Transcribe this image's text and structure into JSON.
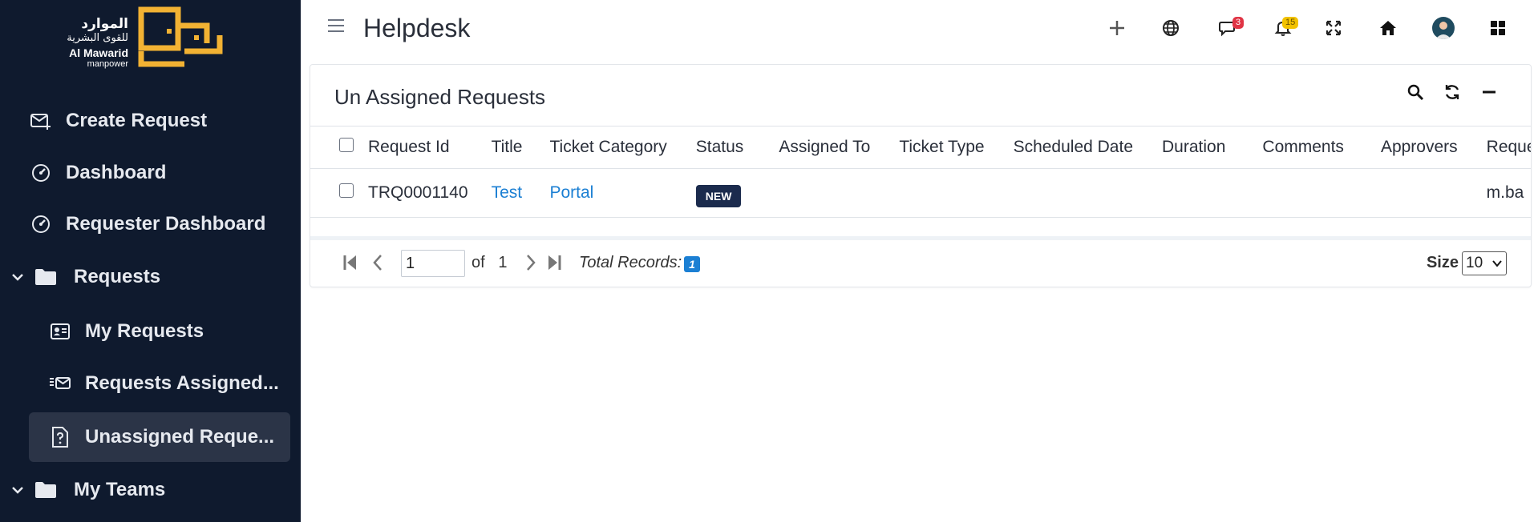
{
  "logo": {
    "arabic_line1": "الموارد",
    "arabic_line2": "للقوى البشرية",
    "english_line1": "Al Mawarid",
    "english_line2": "manpower",
    "accent": "#f2b233"
  },
  "sidebar": {
    "items": [
      {
        "label": "Create Request",
        "icon": "mail-plus-icon"
      },
      {
        "label": "Dashboard",
        "icon": "gauge-icon"
      },
      {
        "label": "Requester Dashboard",
        "icon": "gauge-icon"
      },
      {
        "label": "Requests",
        "icon": "folder-icon"
      },
      {
        "label": "My Requests",
        "icon": "id-card-icon"
      },
      {
        "label": "Requests Assigned...",
        "icon": "mail-list-icon"
      },
      {
        "label": "Unassigned Reque...",
        "icon": "file-question-icon"
      },
      {
        "label": "My Teams",
        "icon": "folder-icon"
      }
    ]
  },
  "header": {
    "title": "Helpdesk",
    "chat_badge": "3",
    "notification_badge": "15"
  },
  "panel": {
    "title": "Un Assigned Requests",
    "columns": [
      "Request Id",
      "Title",
      "Ticket Category",
      "Status",
      "Assigned To",
      "Ticket Type",
      "Scheduled Date",
      "Duration",
      "Comments",
      "Approvers",
      "Requester"
    ],
    "rows": [
      {
        "request_id": "TRQ0001140",
        "title": "Test",
        "ticket_category": "Portal",
        "status": "NEW",
        "requester": "m.ba"
      }
    ]
  },
  "pager": {
    "page_value": "1",
    "of_label": "of",
    "total_pages": "1",
    "total_records_label": "Total Records:",
    "total_records": "1",
    "size_label": "Size",
    "size_value": "10"
  },
  "colors": {
    "sidebar_bg": "#0f1a2e",
    "active_item_bg": "#2b3447",
    "link": "#1b7fd3",
    "status_new": "#1b2b4d",
    "chat_badge": "#e03444",
    "notification_badge": "#f2c200"
  }
}
